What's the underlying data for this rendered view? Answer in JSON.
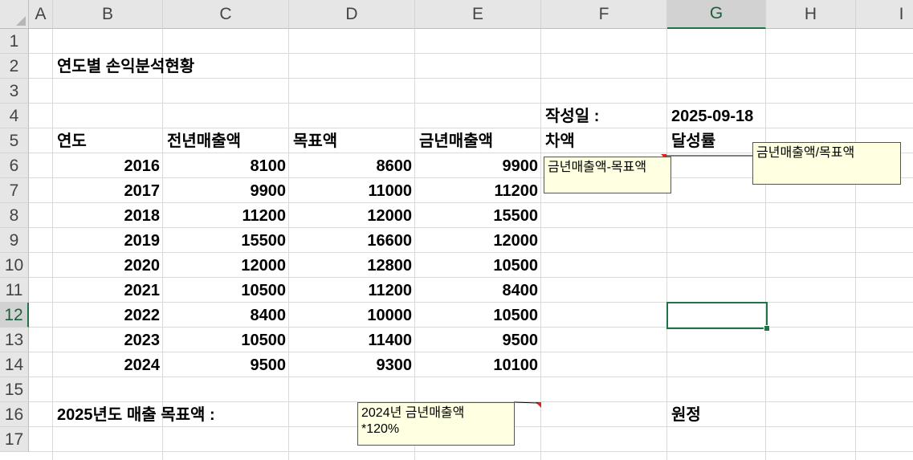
{
  "columns": [
    "A",
    "B",
    "C",
    "D",
    "E",
    "F",
    "G",
    "H",
    "I"
  ],
  "rows": [
    "1",
    "2",
    "3",
    "4",
    "5",
    "6",
    "7",
    "8",
    "9",
    "10",
    "11",
    "12",
    "13",
    "14",
    "15",
    "16",
    "17"
  ],
  "selected_cell": "G12",
  "title": "연도별 손익분석현황",
  "date_label": "작성일 :",
  "date_value": "2025-09-18",
  "table": {
    "headers": [
      "연도",
      "전년매출액",
      "목표액",
      "금년매출액",
      "차액",
      "달성률"
    ],
    "rows": [
      [
        "2016",
        "8100",
        "8600",
        "9900"
      ],
      [
        "2017",
        "9900",
        "11000",
        "11200"
      ],
      [
        "2018",
        "11200",
        "12000",
        "15500"
      ],
      [
        "2019",
        "15500",
        "16600",
        "12000"
      ],
      [
        "2020",
        "12000",
        "12800",
        "10500"
      ],
      [
        "2021",
        "10500",
        "11200",
        "8400"
      ],
      [
        "2022",
        "8400",
        "10000",
        "10500"
      ],
      [
        "2023",
        "10500",
        "11400",
        "9500"
      ],
      [
        "2024",
        "9500",
        "9300",
        "10100"
      ]
    ]
  },
  "target_label": "2025년도 매출 목표액 :",
  "unit_label": "원정",
  "comments": {
    "diff": "금년매출액-목표액",
    "rate": "금년매출액/목표액",
    "target": "2024년 금년매출액\n*120%"
  },
  "colors": {
    "accent": "#217346",
    "comment_bg": "#ffffe1",
    "comment_marker": "#e02020"
  }
}
